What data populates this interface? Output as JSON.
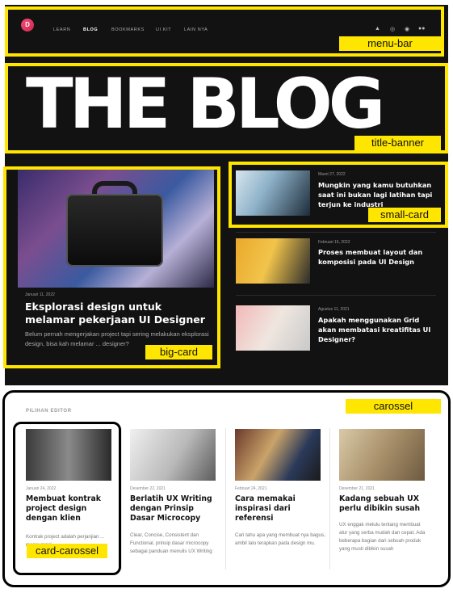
{
  "nav": {
    "logo": "D",
    "items": [
      "LEARN",
      "BLOG",
      "BOOKMARKS",
      "UI KIT",
      "LAIN NYA"
    ],
    "active": "BLOG",
    "social_icons": [
      "twitter-icon",
      "instagram-icon",
      "dribbble-icon",
      "medium-icon"
    ]
  },
  "banner": {
    "title": "THE BLOG"
  },
  "featured": {
    "date": "Januari 11, 2022",
    "title": "Eksplorasi design untuk melamar pekerjaan UI Designer",
    "description": "Belum pernah mengerjakan project tapi sering melakukan eksplorasi design, bisa kah melamar ... designer?"
  },
  "posts": [
    {
      "date": "Maret 27, 2022",
      "title": "Mungkin yang kamu butuhkan saat ini bukan lagi latihan tapi terjun ke industri"
    },
    {
      "date": "Februari 15, 2022",
      "title": "Proses membuat layout dan komposisi pada UI Design"
    },
    {
      "date": "Agustus 11, 2021",
      "title": "Apakah menggunakan Grid akan membatasi kreatifitas UI Designer?"
    }
  ],
  "editor": {
    "label": "PILIHAN EDITOR",
    "cards": [
      {
        "date": "Januari 24, 2022",
        "title": "Membuat kontrak project design dengan klien",
        "description": "Kontrak project adalah perjanjian ... mencurangi."
      },
      {
        "date": "Desember 22, 2021",
        "title": "Berlatih UX Writing dengan Prinsip Dasar Microcopy",
        "description": "Clear, Concise, Consistent dan Functional, prinsip dasar microcopy sebagai panduan menulis UX Writing"
      },
      {
        "date": "Februari 24, 2021",
        "title": "Cara memakai inspirasi dari referensi",
        "description": "Cari tahu apa yang membuat nya bagus, ambil lalu terapkan pada design mu."
      },
      {
        "date": "Desember 21, 2021",
        "title": "Kadang sebuah UX perlu dibikin susah",
        "description": "UX enggak melulu tentang membuat alur yang serba mudah dan cepat. Ada beberapa bagian dari sebuah produk yang musti dibikin susah"
      }
    ]
  },
  "annotations": {
    "menu_bar": "menu-bar",
    "title_banner": "title-banner",
    "small_card": "small-card",
    "big_card": "big-card",
    "carousel": "carossel",
    "card_carousel": "card-carossel"
  },
  "colors": {
    "annotation_yellow": "#ffe600",
    "site_bg": "#121212",
    "accent": "#e0386a"
  }
}
